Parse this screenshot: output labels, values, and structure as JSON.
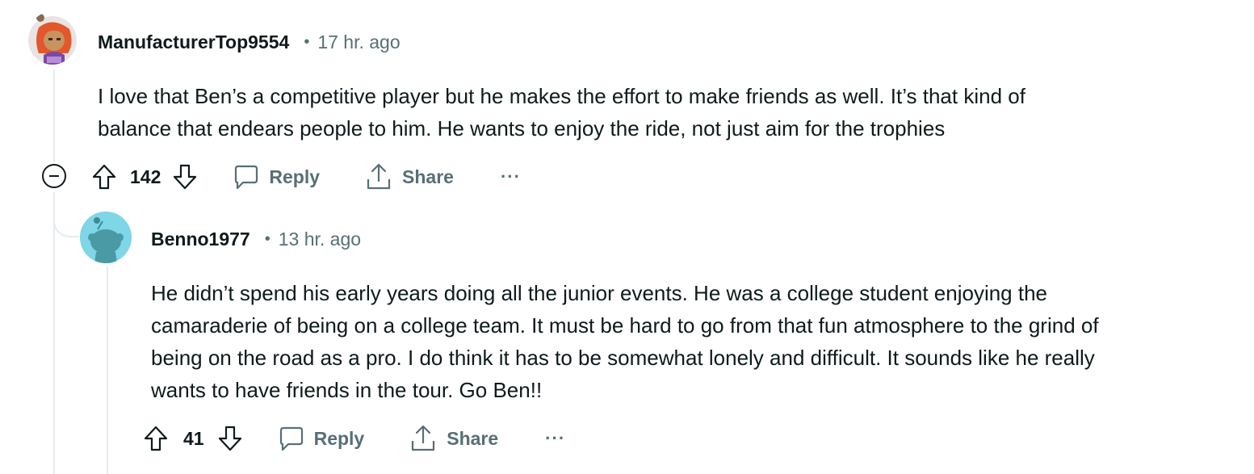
{
  "comments": [
    {
      "username": "ManufacturerTop9554",
      "separator": "•",
      "timestamp": "17 hr. ago",
      "body_lines": [
        "I love that Ben’s a competitive player but he makes the effort to make friends as well. It’s that kind of",
        "balance that endears people to him. He wants to enjoy the ride, not just aim for the trophies"
      ],
      "votes": "142",
      "reply_label": "Reply",
      "share_label": "Share",
      "more_label": "···",
      "avatar_icon": "orange-haired-avatar-icon"
    },
    {
      "username": "Benno1977",
      "separator": "•",
      "timestamp": "13 hr. ago",
      "body_lines": [
        "He didn’t spend his early years doing all the junior events. He was a college student enjoying the",
        "camaraderie of being on a college team. It must be hard to go from that fun atmosphere to the grind of",
        "being on the road as a pro. I do think it has to be somewhat lonely and difficult. It sounds like he really",
        "wants to have friends in the tour. Go Ben!!"
      ],
      "votes": "41",
      "reply_label": "Reply",
      "share_label": "Share",
      "more_label": "···",
      "avatar_icon": "snoo-default-avatar-icon"
    }
  ],
  "collapse_icon": "collapse-minus-icon",
  "colors": {
    "text": "#0f1a1c",
    "meta": "#576f76",
    "thread_line": "#e5ebee",
    "avatar_teal_bg": "#7ed6e6"
  }
}
